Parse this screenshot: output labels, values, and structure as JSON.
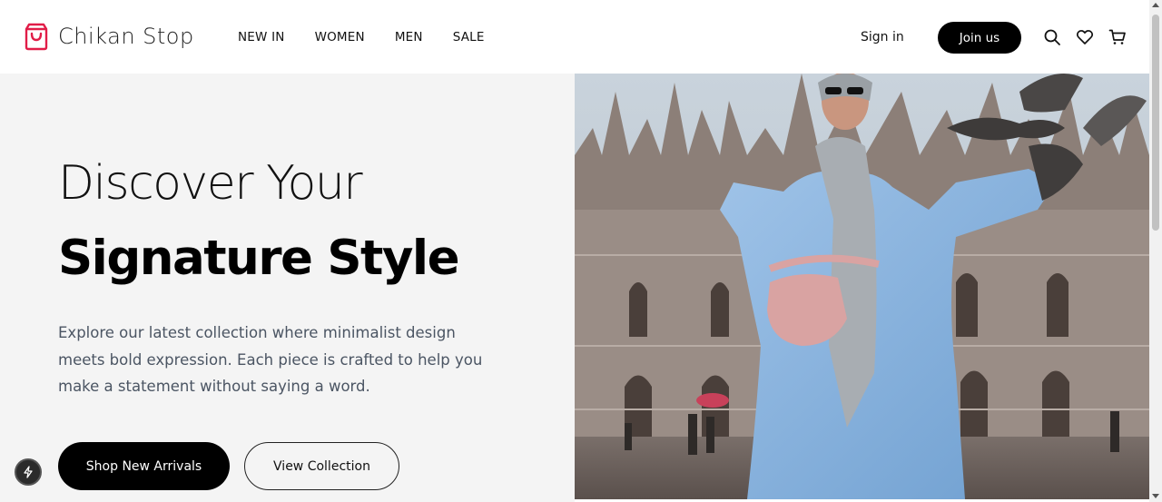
{
  "brand": {
    "name": "Chikan Stop",
    "accent_color": "#e11d48",
    "icon": "shopping-bag-icon"
  },
  "nav": {
    "items": [
      {
        "label": "NEW IN"
      },
      {
        "label": "WOMEN"
      },
      {
        "label": "MEN"
      },
      {
        "label": "SALE"
      }
    ]
  },
  "header_actions": {
    "signin_label": "Sign in",
    "join_label": "Join us",
    "icons": [
      "search-icon",
      "heart-icon",
      "cart-icon"
    ]
  },
  "hero": {
    "title_line1": "Discover Your",
    "title_line2": "Signature Style",
    "description": "Explore our latest collection where minimalist design meets bold expression. Each piece is crafted to help you make a statement without saying a word.",
    "primary_button": "Shop New Arrivals",
    "secondary_button": "View Collection",
    "image_subject": "woman-in-blue-coat-with-pink-bag-in-front-of-cathedral"
  },
  "widgets": {
    "bolt_badge_icon": "lightning-bolt-icon"
  }
}
